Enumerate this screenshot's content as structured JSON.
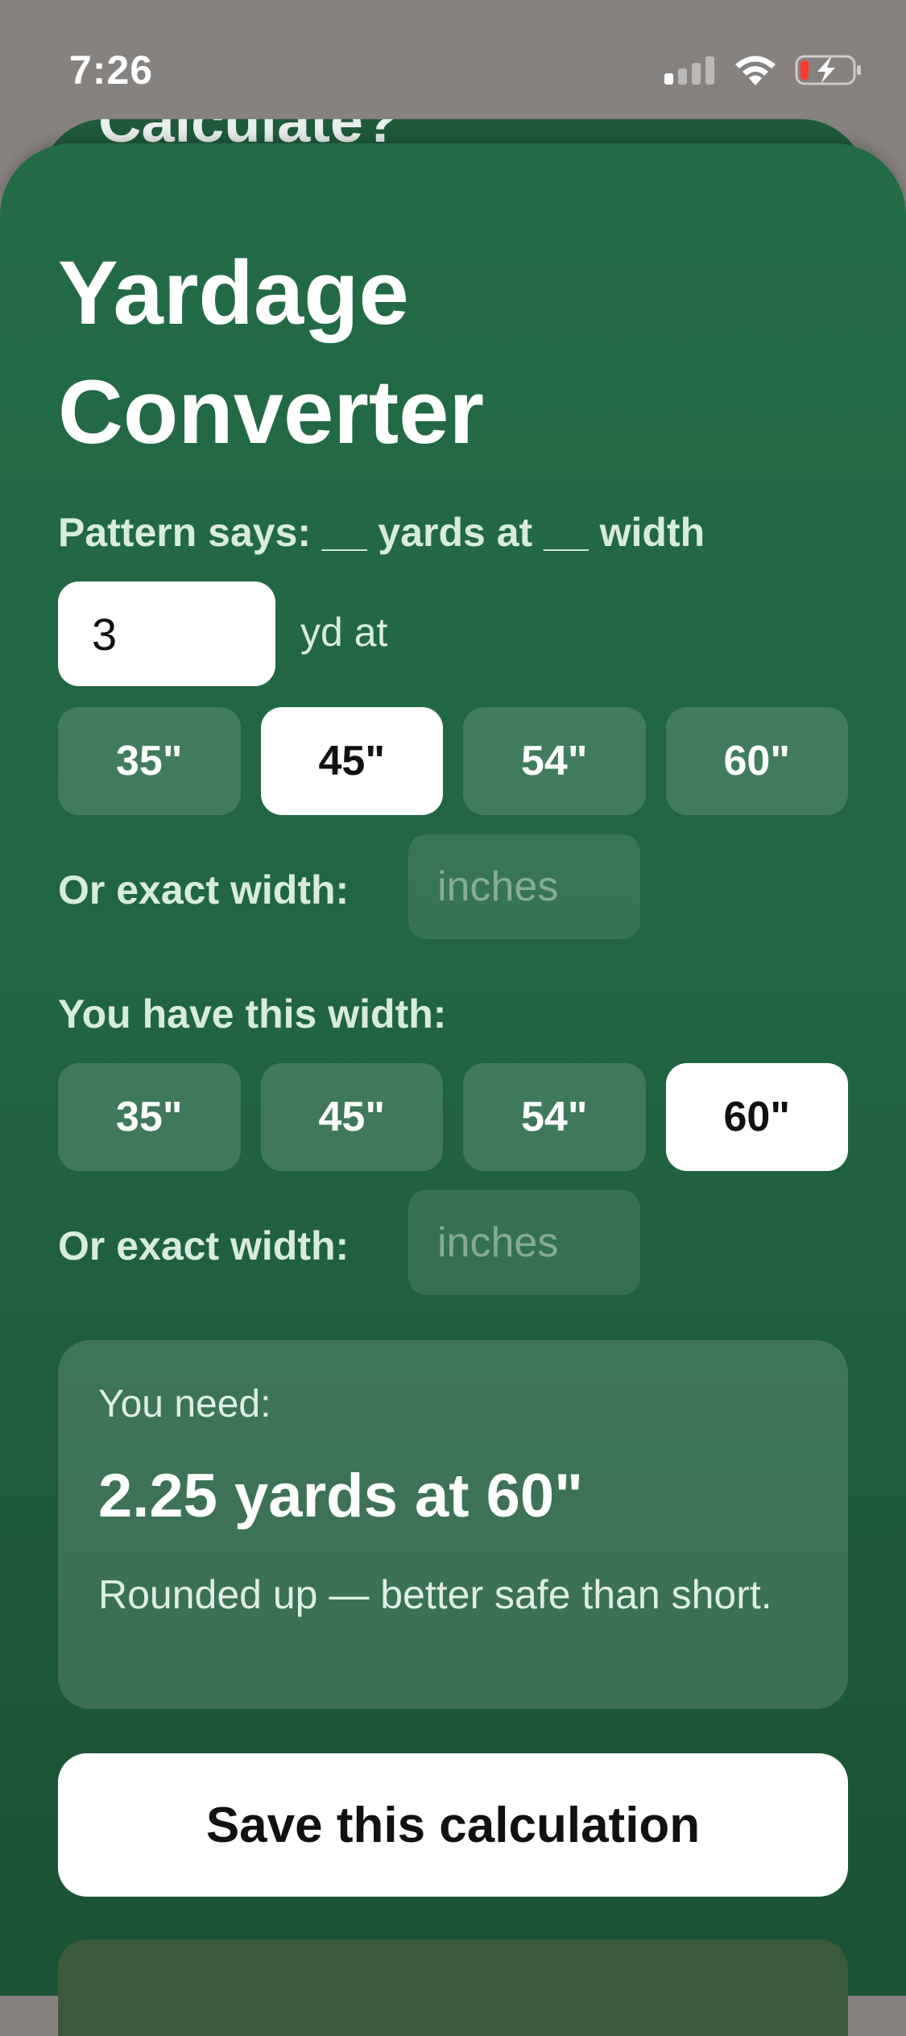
{
  "status_bar": {
    "time": "7:26"
  },
  "background_sheet": {
    "title": "Calculate?"
  },
  "converter": {
    "title": "Yardage Converter",
    "pattern_label": "Pattern says: __ yards at __ width",
    "yards_value": "3",
    "yards_unit": "yd at",
    "pattern_widths": [
      {
        "label": "35\"",
        "selected": false
      },
      {
        "label": "45\"",
        "selected": true
      },
      {
        "label": "54\"",
        "selected": false
      },
      {
        "label": "60\"",
        "selected": false
      }
    ],
    "exact_width_label": "Or exact width:",
    "exact_width_placeholder": "inches",
    "have_label": "You have this width:",
    "have_widths": [
      {
        "label": "35\"",
        "selected": false
      },
      {
        "label": "45\"",
        "selected": false
      },
      {
        "label": "54\"",
        "selected": false
      },
      {
        "label": "60\"",
        "selected": true
      }
    ],
    "have_exact_label": "Or exact width:",
    "have_exact_placeholder": "inches"
  },
  "result": {
    "label": "You need:",
    "value": "2.25 yards at 60\"",
    "note": "Rounded up — better safe than short."
  },
  "save_button_label": "Save this calculation",
  "colors": {
    "sheet_green": "#236b46",
    "selected_chip": "#ffffff",
    "text_light": "#d9ebdf"
  }
}
